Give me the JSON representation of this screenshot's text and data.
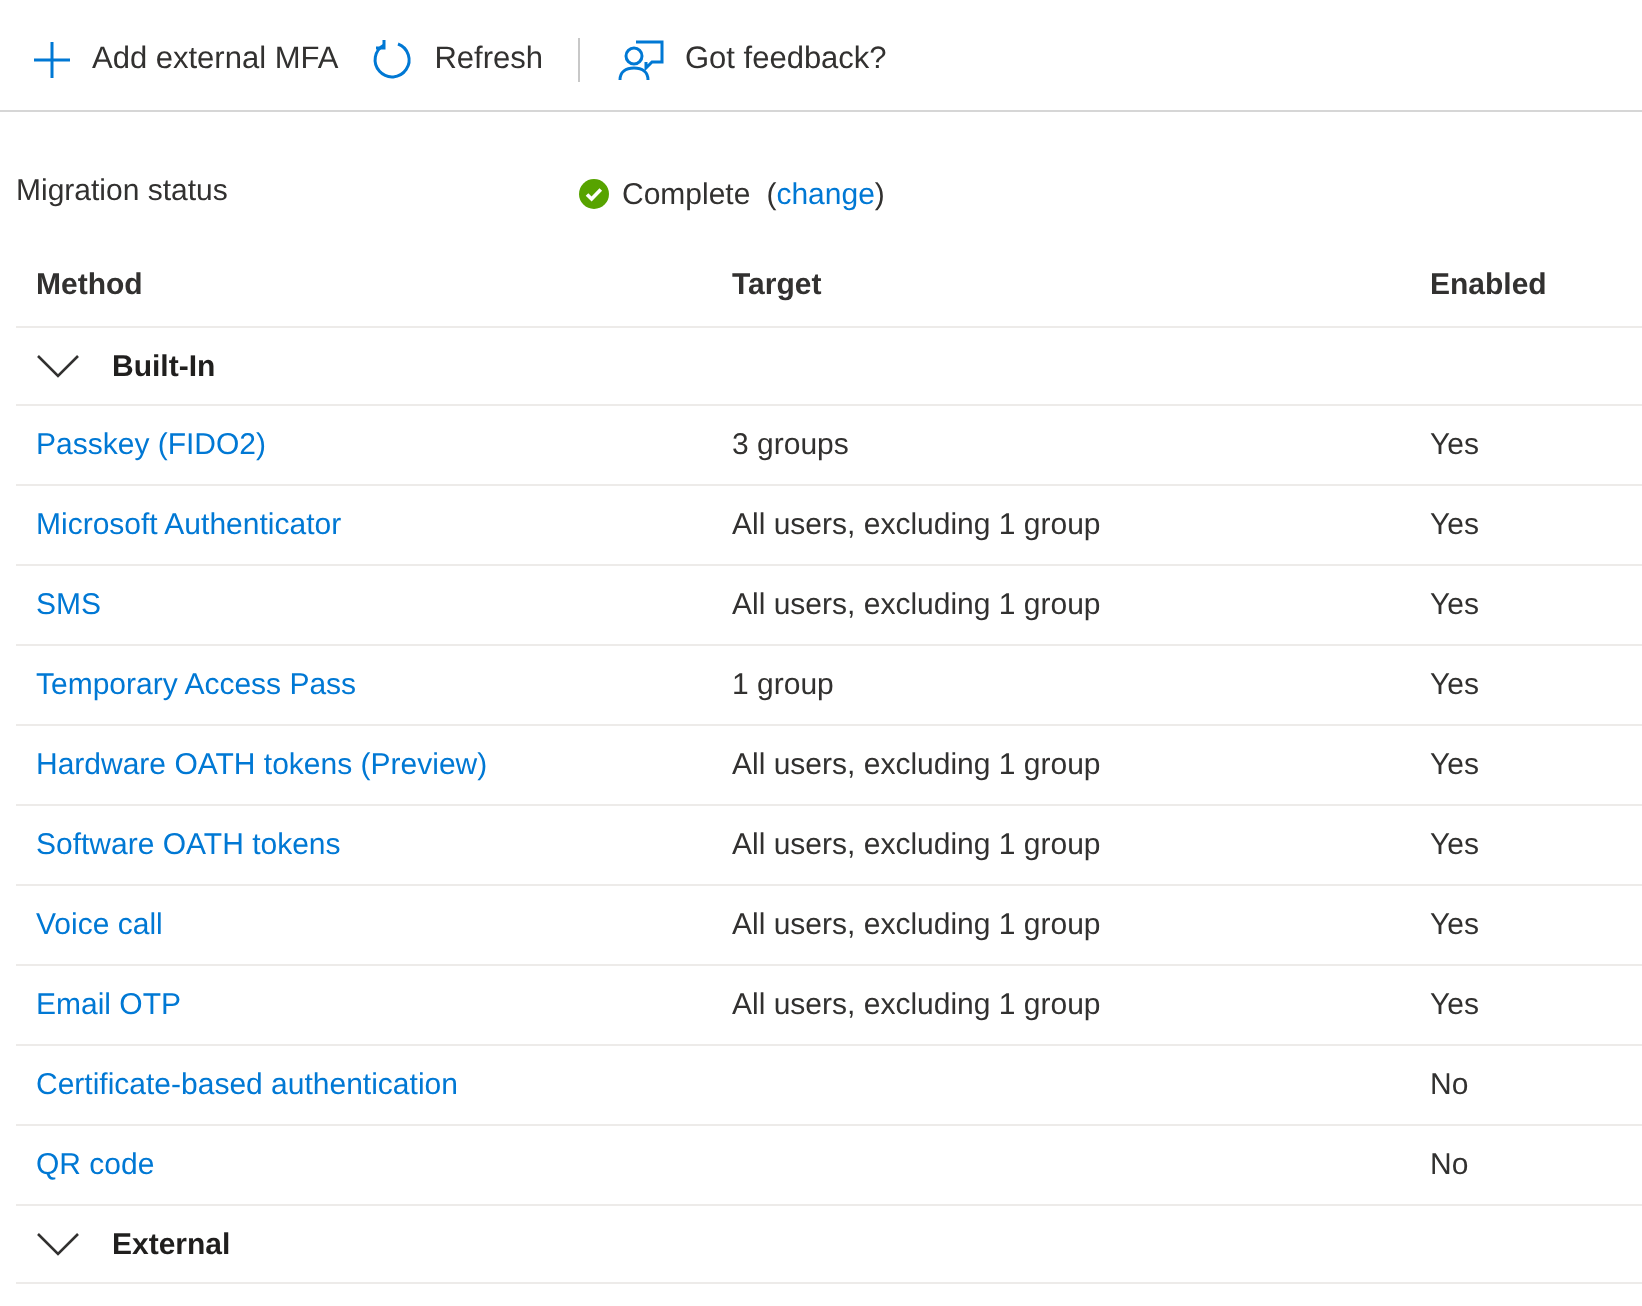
{
  "toolbar": [
    {
      "kind": "add",
      "label": "Add external MFA"
    },
    {
      "kind": "refresh",
      "label": "Refresh"
    },
    {
      "kind": "feedback",
      "label": "Got feedback?"
    }
  ],
  "migration": {
    "label": "Migration status",
    "status": "Complete",
    "paren_open": "(",
    "change_link": "change",
    "paren_close": ")",
    "complete": true
  },
  "table": {
    "columns": [
      "Method",
      "Target",
      "Enabled"
    ],
    "groups": [
      {
        "name": "Built-In",
        "expanded": true,
        "rows": [
          {
            "method": "Passkey (FIDO2)",
            "target": "3 groups",
            "enabled": "Yes"
          },
          {
            "method": "Microsoft Authenticator",
            "target": "All users, excluding 1 group",
            "enabled": "Yes"
          },
          {
            "method": "SMS",
            "target": "All users, excluding 1 group",
            "enabled": "Yes"
          },
          {
            "method": "Temporary Access Pass",
            "target": "1 group",
            "enabled": "Yes"
          },
          {
            "method": "Hardware OATH tokens (Preview)",
            "target": "All users, excluding 1 group",
            "enabled": "Yes"
          },
          {
            "method": "Software OATH tokens",
            "target": "All users, excluding 1 group",
            "enabled": "Yes"
          },
          {
            "method": "Voice call",
            "target": "All users, excluding 1 group",
            "enabled": "Yes"
          },
          {
            "method": "Email OTP",
            "target": "All users, excluding 1 group",
            "enabled": "Yes"
          },
          {
            "method": "Certificate-based authentication",
            "enabled": "No"
          },
          {
            "method": "QR code",
            "enabled": "No"
          }
        ]
      },
      {
        "name": "External",
        "expanded": true
      }
    ]
  }
}
